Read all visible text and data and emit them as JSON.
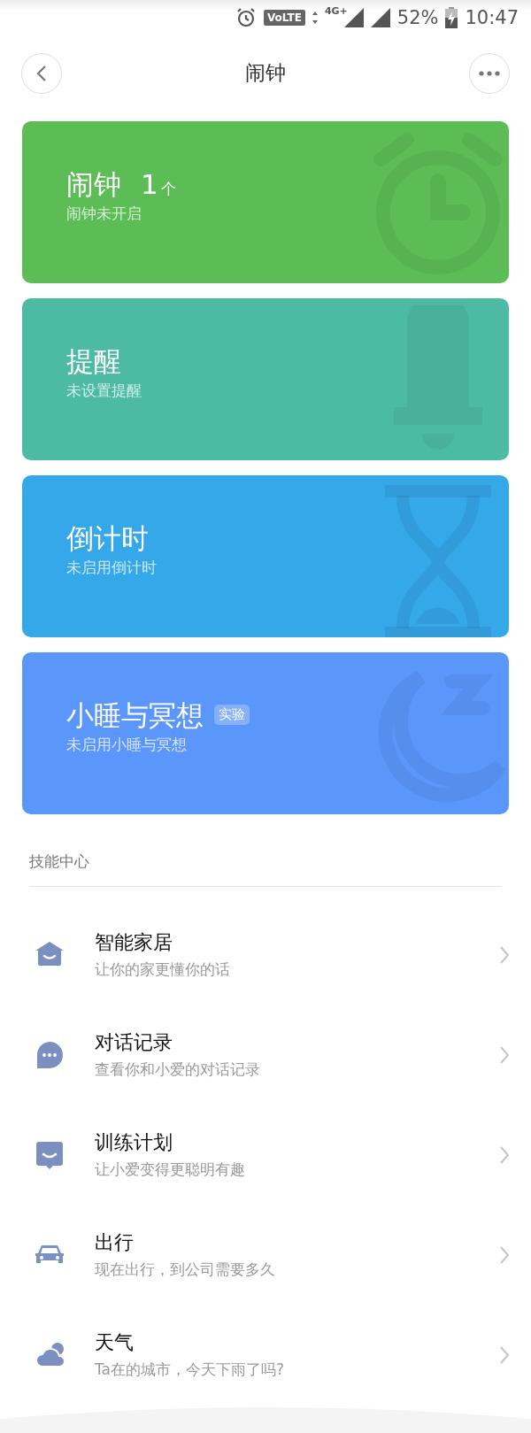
{
  "status_bar": {
    "network_badge": "VoLTE",
    "network_type": "4G+",
    "battery": "52%",
    "time": "10:47"
  },
  "header": {
    "title": "闹钟"
  },
  "cards": [
    {
      "kind": "alarm",
      "color": "#5cbd57",
      "title": "闹钟",
      "count": "1",
      "count_unit": "个",
      "subtitle": "闹钟未开启"
    },
    {
      "kind": "bell",
      "color": "#4dbba3",
      "title": "提醒",
      "subtitle": "未设置提醒"
    },
    {
      "kind": "hourglass",
      "color": "#35a8ea",
      "title": "倒计时",
      "subtitle": "未启用倒计时"
    },
    {
      "kind": "moon",
      "color": "#5b96fb",
      "title": "小睡与冥想",
      "badge": "实验",
      "subtitle": "未启用小睡与冥想"
    }
  ],
  "section": {
    "title": "技能中心"
  },
  "skills": [
    {
      "kind": "home",
      "title": "智能家居",
      "subtitle": "让你的家更懂你的话"
    },
    {
      "kind": "chat",
      "title": "对话记录",
      "subtitle": "查看你和小爱的对话记录"
    },
    {
      "kind": "message",
      "title": "训练计划",
      "subtitle": "让小爱变得更聪明有趣"
    },
    {
      "kind": "car",
      "title": "出行",
      "subtitle": "现在出行，到公司需要多久"
    },
    {
      "kind": "cloud",
      "title": "天气",
      "subtitle": "Ta在的城市，今天下雨了吗?"
    }
  ]
}
